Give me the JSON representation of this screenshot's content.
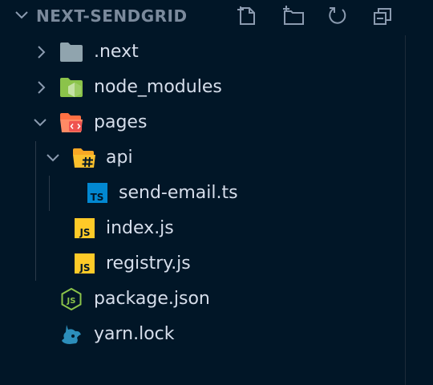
{
  "explorer": {
    "section_title": "NEXT-SENDGRID",
    "actions": [
      {
        "name": "new-file-button",
        "icon": "new-file-icon"
      },
      {
        "name": "new-folder-button",
        "icon": "new-folder-icon"
      },
      {
        "name": "refresh-button",
        "icon": "refresh-icon"
      },
      {
        "name": "collapse-all-button",
        "icon": "collapse-all-icon"
      }
    ]
  },
  "tree": [
    {
      "label": ".next",
      "type": "folder",
      "expanded": false,
      "icon": "folder-icon"
    },
    {
      "label": "node_modules",
      "type": "folder",
      "expanded": false,
      "icon": "node-modules-folder-icon"
    },
    {
      "label": "pages",
      "type": "folder",
      "expanded": true,
      "icon": "pages-folder-icon"
    },
    {
      "label": "api",
      "type": "folder",
      "expanded": true,
      "icon": "api-folder-icon"
    },
    {
      "label": "send-email.ts",
      "type": "file",
      "icon": "typescript-file-icon",
      "badge": "TS"
    },
    {
      "label": "index.js",
      "type": "file",
      "icon": "javascript-file-icon",
      "badge": "JS"
    },
    {
      "label": "registry.js",
      "type": "file",
      "icon": "javascript-file-icon",
      "badge": "JS"
    },
    {
      "label": "package.json",
      "type": "file",
      "icon": "node-json-file-icon"
    },
    {
      "label": "yarn.lock",
      "type": "file",
      "icon": "yarn-file-icon"
    }
  ],
  "colors": {
    "background": "#011627",
    "text": "#d6deeb",
    "header_text": "#7b8a9c",
    "chevron": "#8b9bb0",
    "folder_grey": "#90a4ae",
    "node_green": "#8bc34a",
    "pages_red": "#ff7043",
    "api_yellow": "#fbc02d",
    "ts_blue": "#0288d1",
    "js_yellow": "#ffca28",
    "json_green": "#8bc34a",
    "yarn_blue": "#2c8ebb"
  }
}
